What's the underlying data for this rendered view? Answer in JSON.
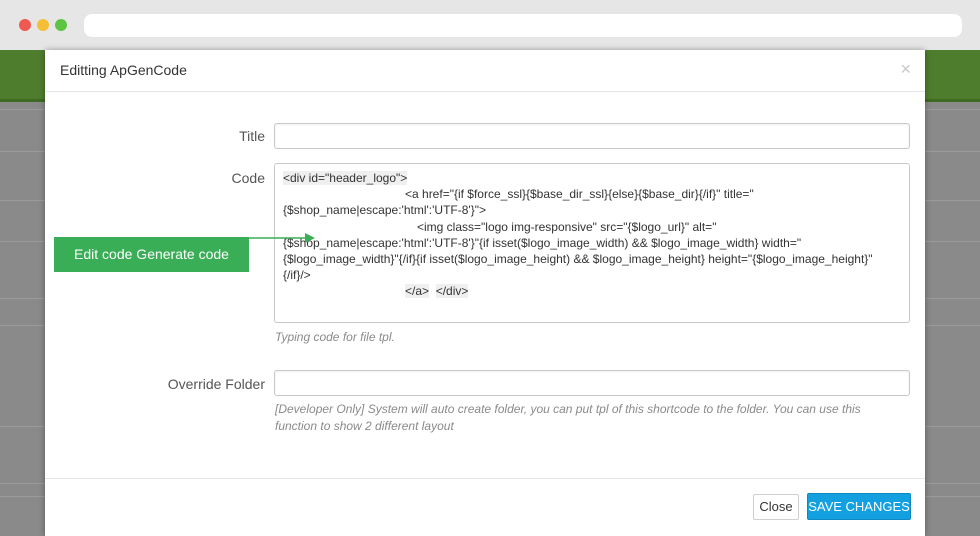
{
  "modal": {
    "title": "Editting ApGenCode",
    "close_icon": "×"
  },
  "form": {
    "title_label": "Title",
    "title_value": "",
    "code_label": "Code",
    "code_lines": [
      "<div id=\"header_logo\">",
      "<a href=\"{if $force_ssl}{$base_dir_ssl}{else}{$base_dir}{/if}\" title=\"",
      "{$shop_name|escape:'html':'UTF-8'}\">",
      "<img class=\"logo img-responsive\" src=\"{$logo_url}\" alt=\"",
      "{$shop_name|escape:'html':'UTF-8'}\"{if isset($logo_image_width) && $logo_image_width} width=\"",
      "{$logo_image_width}\"{/if}{if isset($logo_image_height) && $logo_image_height} height=\"{$logo_image_height}\"",
      "{/if}/>",
      "</a>",
      "</div>"
    ],
    "code_help": "Typing code for file tpl.",
    "override_label": "Override Folder",
    "override_value": "",
    "override_help_1": "[Developer Only] System will auto create folder, you can put tpl of this shortcode to the folder. You can use this",
    "override_help_2": "function to show 2 different layout"
  },
  "buttons": {
    "close": "Close",
    "save": "SAVE CHANGES"
  },
  "callout": {
    "text": "Edit code Generate code"
  },
  "colors": {
    "save_button": "#13a0e0",
    "callout": "#3aae56",
    "header_bar": "#4e7d2e"
  }
}
